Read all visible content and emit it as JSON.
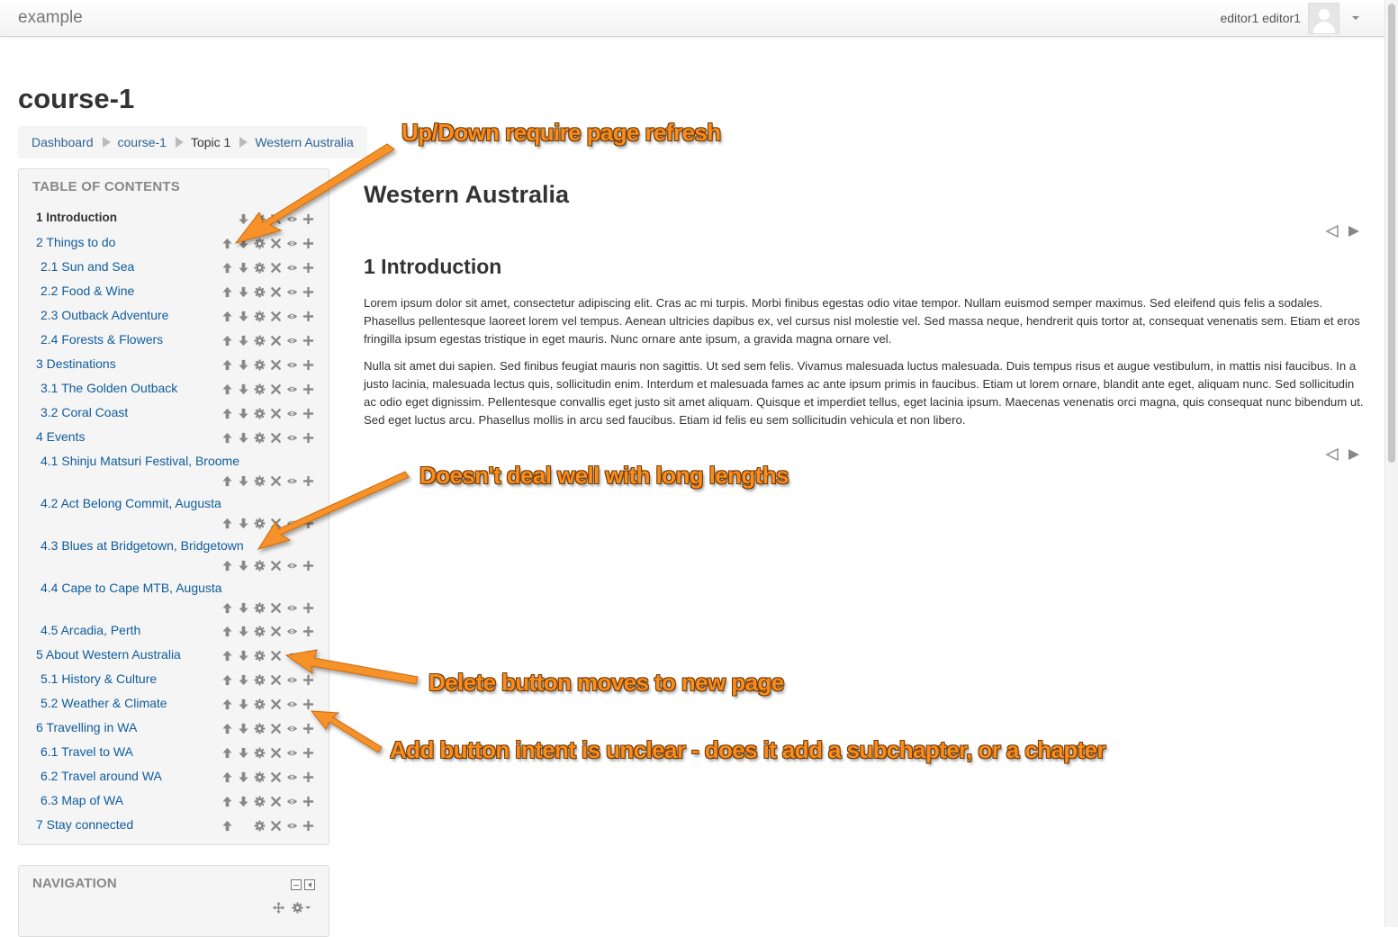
{
  "navbar": {
    "brand": "example",
    "user_name": "editor1 editor1"
  },
  "course_title": "course-1",
  "breadcrumb": [
    "Dashboard",
    "course-1",
    "Topic 1",
    "Western Australia"
  ],
  "toc": {
    "title": "TABLE OF CONTENTS",
    "items": [
      {
        "label": "1 Introduction",
        "active": true,
        "actions": [
          "down",
          "edit",
          "delete",
          "visibility",
          "add"
        ]
      },
      {
        "label": "2 Things to do",
        "actions": [
          "up",
          "down",
          "edit",
          "delete",
          "visibility",
          "add"
        ]
      },
      {
        "label": "2.1 Sun and Sea",
        "actions": [
          "up",
          "down",
          "edit",
          "delete",
          "visibility",
          "add"
        ]
      },
      {
        "label": "2.2 Food & Wine",
        "actions": [
          "up",
          "down",
          "edit",
          "delete",
          "visibility",
          "add"
        ]
      },
      {
        "label": "2.3 Outback Adventure",
        "actions": [
          "up",
          "down",
          "edit",
          "delete",
          "visibility",
          "add"
        ]
      },
      {
        "label": "2.4 Forests & Flowers",
        "actions": [
          "up",
          "down",
          "edit",
          "delete",
          "visibility",
          "add"
        ]
      },
      {
        "label": "3 Destinations",
        "actions": [
          "up",
          "down",
          "edit",
          "delete",
          "visibility",
          "add"
        ]
      },
      {
        "label": "3.1 The Golden Outback",
        "actions": [
          "up",
          "down",
          "edit",
          "delete",
          "visibility",
          "add"
        ]
      },
      {
        "label": "3.2 Coral Coast",
        "actions": [
          "up",
          "down",
          "edit",
          "delete",
          "visibility",
          "add"
        ]
      },
      {
        "label": "4 Events",
        "actions": [
          "up",
          "down",
          "edit",
          "delete",
          "visibility",
          "add"
        ]
      },
      {
        "label": "4.1 Shinju Matsuri Festival, Broome",
        "actions": [
          "up",
          "down",
          "edit",
          "delete",
          "visibility",
          "add"
        ]
      },
      {
        "label": "4.2 Act Belong Commit, Augusta",
        "actions": [
          "up",
          "down",
          "edit",
          "delete",
          "visibility",
          "add"
        ]
      },
      {
        "label": "4.3 Blues at Bridgetown, Bridgetown",
        "actions": [
          "up",
          "down",
          "edit",
          "delete",
          "visibility",
          "add"
        ]
      },
      {
        "label": "4.4 Cape to Cape MTB, Augusta",
        "actions": [
          "up",
          "down",
          "edit",
          "delete",
          "visibility",
          "add"
        ]
      },
      {
        "label": "4.5 Arcadia, Perth",
        "actions": [
          "up",
          "down",
          "edit",
          "delete",
          "visibility",
          "add"
        ]
      },
      {
        "label": "5 About Western Australia",
        "actions": [
          "up",
          "down",
          "edit",
          "delete",
          "visibility",
          "add"
        ]
      },
      {
        "label": "5.1 History & Culture",
        "actions": [
          "up",
          "down",
          "edit",
          "delete",
          "visibility",
          "add"
        ]
      },
      {
        "label": "5.2 Weather & Climate",
        "actions": [
          "up",
          "down",
          "edit",
          "delete",
          "visibility",
          "add"
        ]
      },
      {
        "label": "6 Travelling in WA",
        "actions": [
          "up",
          "down",
          "edit",
          "delete",
          "visibility",
          "add"
        ]
      },
      {
        "label": "6.1 Travel to WA",
        "actions": [
          "up",
          "down",
          "edit",
          "delete",
          "visibility",
          "add"
        ]
      },
      {
        "label": "6.2 Travel around WA",
        "actions": [
          "up",
          "down",
          "edit",
          "delete",
          "visibility",
          "add"
        ]
      },
      {
        "label": "6.3 Map of WA",
        "actions": [
          "up",
          "down",
          "edit",
          "delete",
          "visibility",
          "add"
        ]
      },
      {
        "label": "7 Stay connected",
        "actions": [
          "up",
          "edit",
          "delete",
          "visibility",
          "add"
        ]
      }
    ]
  },
  "navigation_block": {
    "title": "NAVIGATION"
  },
  "content": {
    "page_title": "Western Australia",
    "chapter_title": "1 Introduction",
    "paragraphs": [
      "Lorem ipsum dolor sit amet, consectetur adipiscing elit. Cras ac mi turpis. Morbi finibus egestas odio vitae tempor. Nullam euismod semper maximus. Sed eleifend quis felis a sodales. Phasellus pellentesque laoreet lorem vel tempus. Aenean ultricies dapibus ex, vel cursus nisl molestie vel. Sed massa neque, hendrerit quis tortor at, consequat venenatis sem. Etiam et eros fringilla ipsum egestas tristique in eget mauris. Nunc ornare ante ipsum, a gravida magna ornare vel.",
      "Nulla sit amet dui sapien. Sed finibus feugiat mauris non sagittis. Ut sed sem felis. Vivamus malesuada luctus malesuada. Duis tempus risus et augue vestibulum, in mattis nisi faucibus. In a justo lacinia, malesuada lectus quis, sollicitudin enim. Interdum et malesuada fames ac ante ipsum primis in faucibus. Etiam ut lorem ornare, blandit ante eget, aliquam nunc. Sed sollicitudin ac odio eget dignissim. Pellentesque convallis eget justo sit amet aliquam. Quisque et imperdiet tellus, eget lacinia ipsum. Maecenas venenatis orci magna, quis consequat nunc bibendum ut. Sed eget luctus arcu. Phasellus mollis in arcu sed faucibus. Etiam id felis eu sem sollicitudin vehicula et non libero."
    ]
  },
  "annotations": [
    "Up/Down require page refresh",
    "Doesn't deal well with long lengths",
    "Delete button moves to new page",
    "Add button intent is unclear - does it add a subchapter, or a chapter"
  ],
  "colors": {
    "link": "#0f5c9c",
    "annotation": "#fb8c1c",
    "block_bg": "#f5f5f5"
  }
}
